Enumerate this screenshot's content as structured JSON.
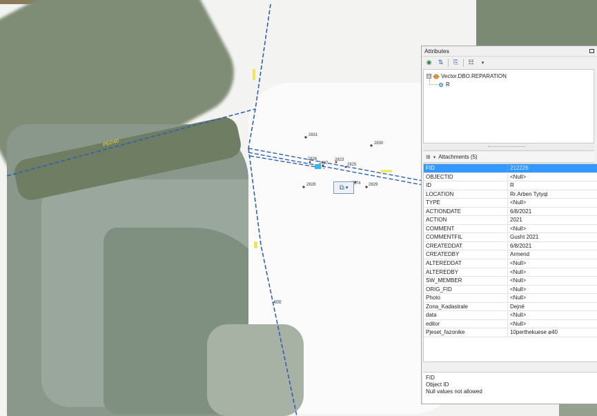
{
  "map": {
    "points": [
      {
        "label": "2831"
      },
      {
        "label": "2830"
      },
      {
        "label": "2826"
      },
      {
        "label": "2827"
      },
      {
        "label": "2823"
      },
      {
        "label": "2825"
      },
      {
        "label": "2828"
      },
      {
        "label": "2874"
      },
      {
        "label": "2829"
      }
    ],
    "line_labels": {
      "line_a": "PE∅40",
      "line_c": "400"
    }
  },
  "attributes": {
    "title": "Attributes",
    "layer_name": "Vector.DBO.REPARATION",
    "feature_name": "R",
    "tree_expander": "⊟",
    "attachments_label": "Attachments (5)",
    "rows": [
      {
        "field": "FID",
        "value": "212226"
      },
      {
        "field": "OBJECTID",
        "value": "<Null>"
      },
      {
        "field": "ID",
        "value": "R"
      },
      {
        "field": "LOCATION",
        "value": "Rr.Arben Tytyqi"
      },
      {
        "field": "TYPE",
        "value": "<Null>"
      },
      {
        "field": "ACTIONDATE",
        "value": "6/8/2021"
      },
      {
        "field": "ACTION",
        "value": "2021"
      },
      {
        "field": "COMMENT",
        "value": "<Null>"
      },
      {
        "field": "COMMENTFIL",
        "value": "Gusht 2021"
      },
      {
        "field": "CREATEDDAT",
        "value": "6/8/2021"
      },
      {
        "field": "CREATEDBY",
        "value": "Armend"
      },
      {
        "field": "ALTEREDDAT",
        "value": "<Null>"
      },
      {
        "field": "ALTEREDBY",
        "value": "<Null>"
      },
      {
        "field": "SW_MEMBER",
        "value": "<Null>"
      },
      {
        "field": "ORIG_FID",
        "value": "<Null>"
      },
      {
        "field": "Photo",
        "value": "<Null>"
      },
      {
        "field": "Zona_Kadastrale",
        "value": "Dejnë"
      },
      {
        "field": "data",
        "value": "<Null>"
      },
      {
        "field": "editor",
        "value": "<Null>"
      },
      {
        "field": "Pjeset_fazonike",
        "value": "10perthekuese ø40"
      }
    ],
    "description": {
      "field": "FID",
      "line1": "Object ID",
      "line2": "Null values not allowed"
    }
  },
  "colors": {
    "selection": "#3399ff",
    "network_line": "#2f5fb3",
    "line_label": "#e7e23a"
  }
}
